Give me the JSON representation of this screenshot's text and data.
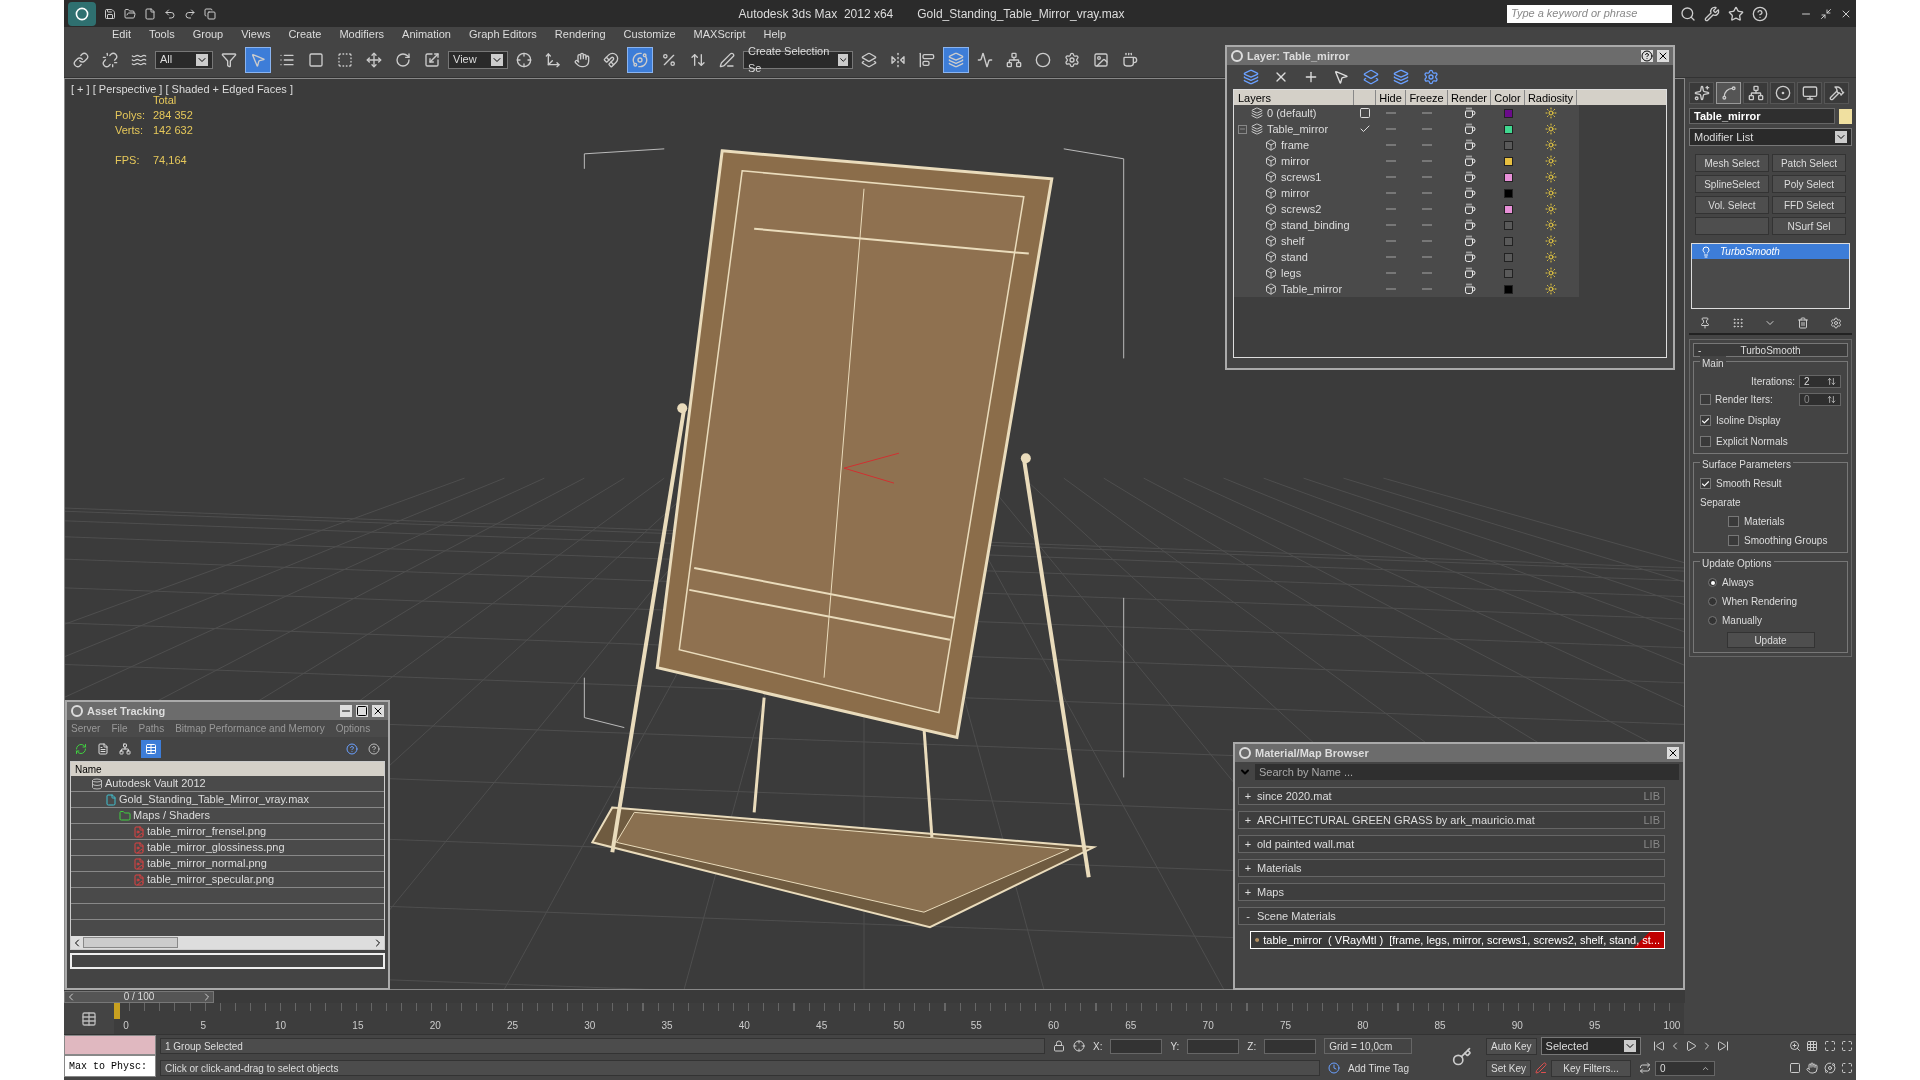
{
  "title_bar": {
    "app": "Autodesk 3ds Max  2012 x64",
    "file": "Gold_Standing_Table_Mirror_vray.max",
    "search_placeholder": "Type a keyword or phrase"
  },
  "menu": [
    "Edit",
    "Tools",
    "Group",
    "Views",
    "Create",
    "Modifiers",
    "Animation",
    "Graph Editors",
    "Rendering",
    "Customize",
    "MAXScript",
    "Help"
  ],
  "toolbar": {
    "selection_filter": "All",
    "reference_coordinate": "View",
    "named_selection": "Create Selection Se",
    "buttons": [
      {
        "kind": "link",
        "selected": false
      },
      {
        "kind": "unlink",
        "selected": false
      },
      {
        "kind": "bind",
        "selected": false
      },
      {
        "kind": "filter",
        "selected": false
      },
      {
        "kind": "select",
        "selected": true
      },
      {
        "kind": "select_by_name",
        "selected": false
      },
      {
        "kind": "rect_region",
        "selected": false
      },
      {
        "kind": "window_crossing",
        "selected": false
      },
      {
        "kind": "move",
        "selected": false
      },
      {
        "kind": "rotate",
        "selected": false
      },
      {
        "kind": "scale",
        "selected": false
      },
      {
        "kind": "coord",
        "selected": false
      },
      {
        "kind": "pivot",
        "selected": false
      },
      {
        "kind": "manipulate",
        "selected": false
      },
      {
        "kind": "snap",
        "selected": false
      },
      {
        "kind": "angle_snap",
        "selected": true
      },
      {
        "kind": "percent_snap",
        "selected": false
      },
      {
        "kind": "spinner_snap",
        "selected": false
      },
      {
        "kind": "edit_named",
        "selected": false
      },
      {
        "kind": "named",
        "selected": false
      },
      {
        "kind": "mirror",
        "selected": false
      },
      {
        "kind": "align",
        "selected": false
      },
      {
        "kind": "layers",
        "selected": true
      },
      {
        "kind": "curve_editor",
        "selected": false
      },
      {
        "kind": "schematic",
        "selected": false
      },
      {
        "kind": "material",
        "selected": false
      },
      {
        "kind": "render_setup",
        "selected": false
      },
      {
        "kind": "frame_window",
        "selected": false
      },
      {
        "kind": "render",
        "selected": false
      }
    ]
  },
  "viewport": {
    "label": "[ + ] [ Perspective ] [ Shaded + Edged Faces ]",
    "stats_title": "Total",
    "stats": [
      {
        "label": "Polys:",
        "value": "284 352"
      },
      {
        "label": "Verts:",
        "value": "142 632"
      }
    ],
    "fps": {
      "label": "FPS:",
      "value": "74,164"
    }
  },
  "layer_dialog": {
    "title": "Layer: Table_mirror",
    "columns": [
      "Layers",
      "Hide",
      "Freeze",
      "Render",
      "Color",
      "Radiosity"
    ],
    "rows": [
      {
        "name": "0 (default)",
        "kind": "layer",
        "current": false,
        "color": "#6a0a8a"
      },
      {
        "name": "Table_mirror",
        "kind": "layer",
        "current": true,
        "expanded": true,
        "color": "#40d890",
        "children": [
          {
            "name": "frame",
            "kind": "object",
            "color": "#5a5a5a"
          },
          {
            "name": "mirror",
            "kind": "object",
            "color": "#e8c040"
          },
          {
            "name": "screws1",
            "kind": "object",
            "color": "#e890d8"
          },
          {
            "name": "mirror",
            "kind": "object",
            "color": "#000000"
          },
          {
            "name": "screws2",
            "kind": "object",
            "color": "#e890d8"
          },
          {
            "name": "stand_binding",
            "kind": "object",
            "color": "#5a5a5a"
          },
          {
            "name": "shelf",
            "kind": "object",
            "color": "#5a5a5a"
          },
          {
            "name": "stand",
            "kind": "object",
            "color": "#5a5a5a"
          },
          {
            "name": "legs",
            "kind": "object",
            "color": "#5a5a5a"
          },
          {
            "name": "Table_mirror",
            "kind": "object",
            "color": "#000000"
          }
        ]
      }
    ]
  },
  "command_panel": {
    "tabs": [
      {
        "kind": "create",
        "selected": false
      },
      {
        "kind": "modify",
        "selected": true
      },
      {
        "kind": "hierarchy",
        "selected": false
      },
      {
        "kind": "motion",
        "selected": false
      },
      {
        "kind": "display",
        "selected": false
      },
      {
        "kind": "utilities",
        "selected": false
      }
    ],
    "object_name": "Table_mirror",
    "modifier_list": "Modifier List",
    "modifier_buttons": [
      {
        "kind": "button",
        "label": "Mesh Select"
      },
      {
        "kind": "button",
        "label": "Patch Select"
      },
      {
        "kind": "button",
        "label": "SplineSelect"
      },
      {
        "kind": "button",
        "label": "Poly Select"
      },
      {
        "kind": "button",
        "label": "Vol. Select"
      },
      {
        "kind": "button",
        "label": "FFD Select"
      },
      {
        "kind": "blank"
      },
      {
        "kind": "button",
        "label": "NSurf Sel"
      }
    ],
    "stack": [
      {
        "name": "TurboSmooth",
        "selected": true
      }
    ],
    "rollout": {
      "title": "TurboSmooth",
      "collapse": "-",
      "main": {
        "title": "Main",
        "iterations": {
          "label": "Iterations:",
          "value": "2"
        },
        "render_iters": {
          "label": "Render Iters:",
          "value": "0",
          "checked": false
        },
        "options": [
          {
            "label": "Isoline Display",
            "checked": true
          },
          {
            "label": "Explicit Normals",
            "checked": false
          }
        ]
      },
      "surface": {
        "title": "Surface Parameters",
        "smooth_result": {
          "label": "Smooth Result",
          "checked": true
        },
        "separate": "Separate",
        "options": [
          {
            "label": "Materials",
            "checked": false
          },
          {
            "label": "Smoothing Groups",
            "checked": false
          }
        ]
      },
      "update": {
        "title": "Update Options",
        "options": [
          {
            "label": "Always",
            "selected": true
          },
          {
            "label": "When Rendering",
            "selected": false
          },
          {
            "label": "Manually",
            "selected": false
          }
        ],
        "button": "Update"
      }
    }
  },
  "asset_tracking": {
    "title": "Asset Tracking",
    "menu": [
      "Server",
      "File",
      "Paths",
      "Bitmap Performance and Memory",
      "Options"
    ],
    "column": "Name",
    "rows": [
      {
        "name": "Autodesk Vault 2012",
        "kind": "vault",
        "children": [
          {
            "name": "Gold_Standing_Table_Mirror_vray.max",
            "kind": "max_file",
            "children": [
              {
                "name": "Maps / Shaders",
                "kind": "folder",
                "children": [
                  {
                    "name": "table_mirror_frensel.png",
                    "kind": "bitmap"
                  },
                  {
                    "name": "table_mirror_glossiness.png",
                    "kind": "bitmap"
                  },
                  {
                    "name": "table_mirror_normal.png",
                    "kind": "bitmap"
                  },
                  {
                    "name": "table_mirror_specular.png",
                    "kind": "bitmap"
                  }
                ]
              }
            ]
          }
        ]
      }
    ]
  },
  "material_browser": {
    "title": "Material/Map Browser",
    "search_placeholder": "Search by Name ...",
    "groups": [
      {
        "sign": "+",
        "label": "since 2020.mat",
        "tag": "LIB"
      },
      {
        "sign": "+",
        "label": "ARCHITECTURAL GREEN GRASS by ark_mauricio.mat",
        "tag": "LIB"
      },
      {
        "sign": "+",
        "label": "old painted wall.mat",
        "tag": "LIB"
      },
      {
        "sign": "+",
        "label": "Materials"
      },
      {
        "sign": "+",
        "label": "Maps"
      },
      {
        "sign": "-",
        "label": "Scene Materials"
      }
    ],
    "scene_material": "table_mirror  ( VRayMtl )  [frame, legs, mirror, screws1, screws2, shelf, stand, st..."
  },
  "timeline": {
    "position": "0 / 100",
    "level": 0,
    "ticks": [
      "0",
      "5",
      "10",
      "15",
      "20",
      "25",
      "30",
      "35",
      "40",
      "45",
      "50",
      "55",
      "60",
      "65",
      "70",
      "75",
      "80",
      "85",
      "90",
      "95",
      "100"
    ]
  },
  "status": {
    "listener": "Max to Physc:",
    "selection": "1 Group Selected",
    "prompt": "Click or click-and-drag to select objects",
    "x_label": "X:",
    "y_label": "Y:",
    "z_label": "Z:",
    "grid": "Grid = 10,0cm",
    "time_tag": "Add Time Tag",
    "auto_key": "Auto Key",
    "key_mode": "Selected",
    "set_key": "Set Key",
    "key_filters": "Key Filters...",
    "frame": "0"
  }
}
